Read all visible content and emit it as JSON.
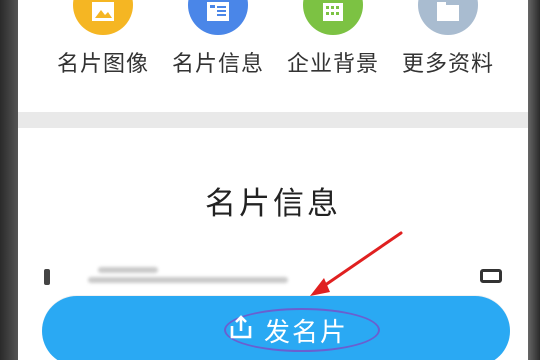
{
  "menu": {
    "items": [
      {
        "label": "名片图像",
        "icon": "image-icon",
        "color": "#f5b623"
      },
      {
        "label": "名片信息",
        "icon": "card-info-icon",
        "color": "#4a86e8"
      },
      {
        "label": "企业背景",
        "icon": "building-icon",
        "color": "#7cc243"
      },
      {
        "label": "更多资料",
        "icon": "folder-icon",
        "color": "#a9bcd0"
      }
    ]
  },
  "card": {
    "title": "名片信息"
  },
  "send_button": {
    "label": "发名片",
    "icon": "share-icon",
    "color": "#2aa9f3"
  },
  "annotation": {
    "color": "#e02020"
  }
}
